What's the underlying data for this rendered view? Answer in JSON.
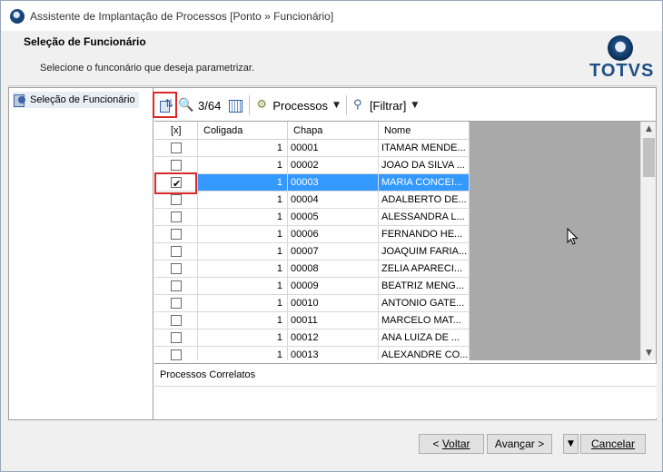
{
  "window": {
    "title": "Assistente de Implantação de Processos [Ponto » Funcionário]"
  },
  "header": {
    "title": "Seleção de Funcionário",
    "subtitle": "Selecione o funconário que deseja parametrizar.",
    "logo_text": "TOTVS"
  },
  "left_panel": {
    "items": [
      {
        "label": "Seleção de Funcionário",
        "icon": "page-icon"
      }
    ]
  },
  "toolbar": {
    "refresh_icon": "refresh-icon",
    "find_icon": "binoculars-icon",
    "record_count": "3/64",
    "grid_icon": "grid-icon",
    "processos_label": "Processos",
    "filtrar_label": "[Filtrar]"
  },
  "grid": {
    "columns": [
      "[x]",
      "Coligada",
      "Chapa",
      "Nome"
    ],
    "rows": [
      {
        "checked": false,
        "coligada": "1",
        "chapa": "00001",
        "nome": "ITAMAR MENDE..."
      },
      {
        "checked": false,
        "coligada": "1",
        "chapa": "00002",
        "nome": "JOAO DA SILVA ..."
      },
      {
        "checked": true,
        "coligada": "1",
        "chapa": "00003",
        "nome": "MARIA CONCEI..."
      },
      {
        "checked": false,
        "coligada": "1",
        "chapa": "00004",
        "nome": "ADALBERTO DE..."
      },
      {
        "checked": false,
        "coligada": "1",
        "chapa": "00005",
        "nome": "ALESSANDRA L..."
      },
      {
        "checked": false,
        "coligada": "1",
        "chapa": "00006",
        "nome": "FERNANDO HE..."
      },
      {
        "checked": false,
        "coligada": "1",
        "chapa": "00007",
        "nome": "JOAQUIM FARIA..."
      },
      {
        "checked": false,
        "coligada": "1",
        "chapa": "00008",
        "nome": "ZELIA APARECI..."
      },
      {
        "checked": false,
        "coligada": "1",
        "chapa": "00009",
        "nome": "BEATRIZ MENG..."
      },
      {
        "checked": false,
        "coligada": "1",
        "chapa": "00010",
        "nome": "ANTONIO GATE..."
      },
      {
        "checked": false,
        "coligada": "1",
        "chapa": "00011",
        "nome": "MARCELO MAT..."
      },
      {
        "checked": false,
        "coligada": "1",
        "chapa": "00012",
        "nome": "ANA LUIZA  DE ..."
      },
      {
        "checked": false,
        "coligada": "1",
        "chapa": "00013",
        "nome": "ALEXANDRE CO..."
      }
    ],
    "selected_index": 2
  },
  "correlatos": {
    "label": "Processos Correlatos"
  },
  "buttons": {
    "voltar_prefix": "< ",
    "voltar_label": "Voltar",
    "avancar_prefix": "Avan",
    "avancar_ul": "ç",
    "avancar_suffix": "ar >",
    "cancelar_label": "Cancelar"
  },
  "colors": {
    "selection": "#3399ff",
    "brand": "#1f4f85",
    "highlight_box": "#d9292a"
  }
}
